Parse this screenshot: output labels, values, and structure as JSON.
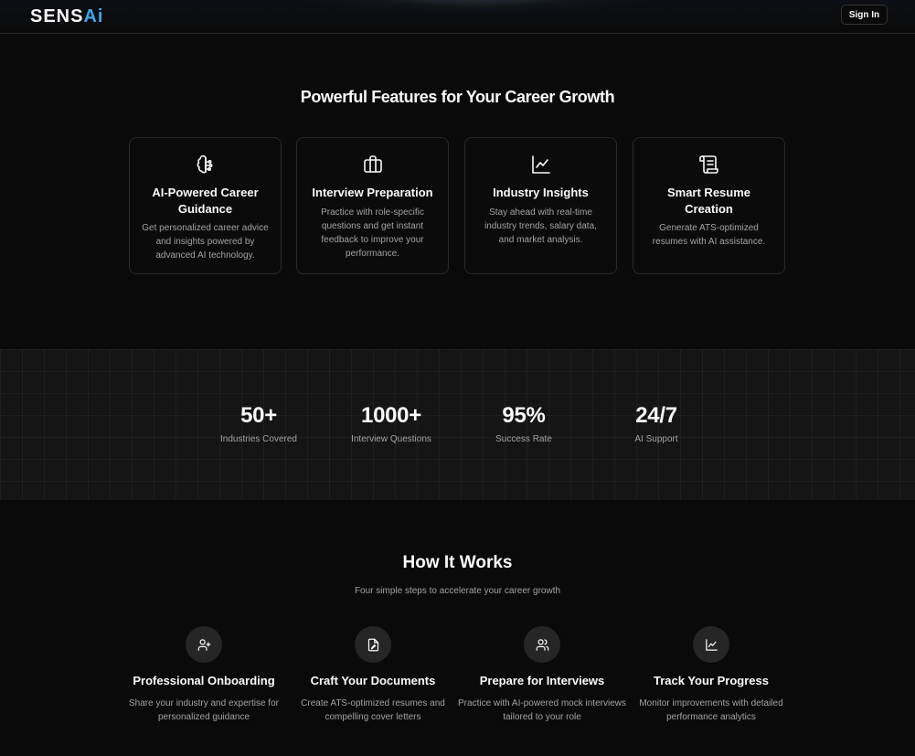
{
  "header": {
    "logo_main": "SENS",
    "logo_accent": "Ai",
    "signin_label": "Sign In"
  },
  "features": {
    "title": "Powerful Features for Your Career Growth",
    "cards": [
      {
        "icon": "brain-icon",
        "title": "AI-Powered Career Guidance",
        "desc": "Get personalized career advice and insights powered by advanced AI technology."
      },
      {
        "icon": "briefcase-icon",
        "title": "Interview Preparation",
        "desc": "Practice with role-specific questions and get instant feedback to improve your performance."
      },
      {
        "icon": "line-chart-icon",
        "title": "Industry Insights",
        "desc": "Stay ahead with real-time industry trends, salary data, and market analysis."
      },
      {
        "icon": "scroll-icon",
        "title": "Smart Resume Creation",
        "desc": "Generate ATS-optimized resumes with AI assistance."
      }
    ]
  },
  "stats": [
    {
      "value": "50+",
      "label": "Industries Covered"
    },
    {
      "value": "1000+",
      "label": "Interview Questions"
    },
    {
      "value": "95%",
      "label": "Success Rate"
    },
    {
      "value": "24/7",
      "label": "AI Support"
    }
  ],
  "how": {
    "title": "How It Works",
    "subtitle": "Four simple steps to accelerate your career growth",
    "steps": [
      {
        "icon": "user-plus-icon",
        "title": "Professional Onboarding",
        "desc": "Share your industry and expertise for personalized guidance"
      },
      {
        "icon": "file-edit-icon",
        "title": "Craft Your Documents",
        "desc": "Create ATS-optimized resumes and compelling cover letters"
      },
      {
        "icon": "users-icon",
        "title": "Prepare for Interviews",
        "desc": "Practice with AI-powered mock interviews tailored to your role"
      },
      {
        "icon": "line-chart-icon",
        "title": "Track Your Progress",
        "desc": "Monitor improvements with detailed performance analytics"
      }
    ]
  },
  "colors": {
    "background": "#0a0a0a",
    "accent": "#3ea6e8",
    "muted_text": "#a3a3a3",
    "card_border": "#2a2a2a"
  }
}
